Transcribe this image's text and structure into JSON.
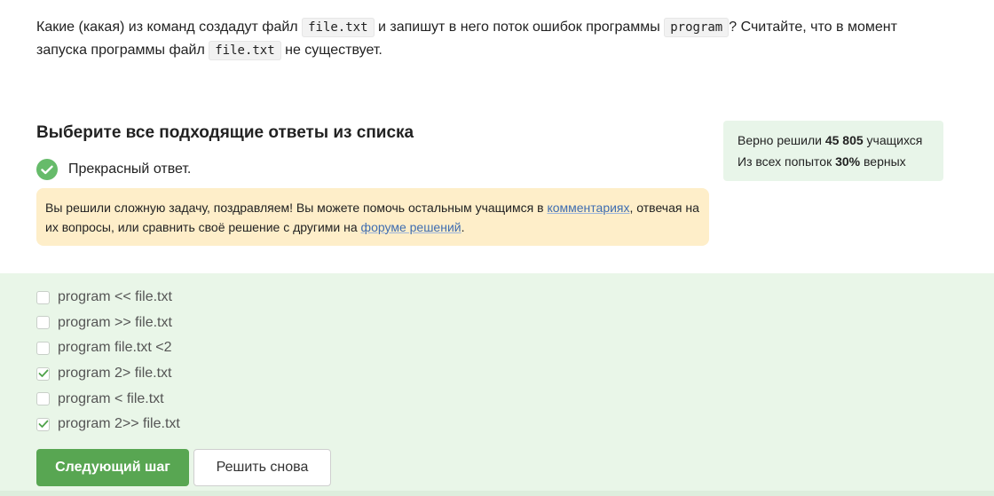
{
  "question": {
    "part1": "Какие (какая) из команд создадут файл ",
    "code1": "file.txt",
    "part2": " и запишут в него поток ошибок программы ",
    "code2": "program",
    "part3": "? Считайте, что в момент запуска программы файл ",
    "code3": "file.txt",
    "part4": " не существует."
  },
  "heading": "Выберите все подходящие ответы из списка",
  "status": {
    "text": "Прекрасный ответ.",
    "icon": "check-circle-icon",
    "color": "#66bb6a"
  },
  "stats": {
    "line1_prefix": "Верно решили ",
    "line1_count": "45 805",
    "line1_suffix": " учащихся",
    "line2_prefix": "Из всех попыток ",
    "line2_percent": "30%",
    "line2_suffix": " верных"
  },
  "congrats": {
    "part1": "Вы решили сложную задачу, поздравляем! Вы можете помочь остальным учащимся в ",
    "link1": "комментариях",
    "part2": ", отвечая на их вопросы, или сравнить своё решение с другими на ",
    "link2": "форуме решений",
    "part3": "."
  },
  "options": [
    {
      "label": "program << file.txt",
      "checked": false
    },
    {
      "label": "program >> file.txt",
      "checked": false
    },
    {
      "label": "program file.txt <2",
      "checked": false
    },
    {
      "label": "program 2> file.txt",
      "checked": true
    },
    {
      "label": "program < file.txt",
      "checked": false
    },
    {
      "label": "program 2>> file.txt",
      "checked": true
    }
  ],
  "buttons": {
    "next": "Следующий шаг",
    "retry": "Решить снова"
  },
  "colors": {
    "accent": "#58a652",
    "answer_bg": "#e9f6e8",
    "notice_bg": "#feeec9",
    "stats_bg": "#e8f5e9"
  }
}
